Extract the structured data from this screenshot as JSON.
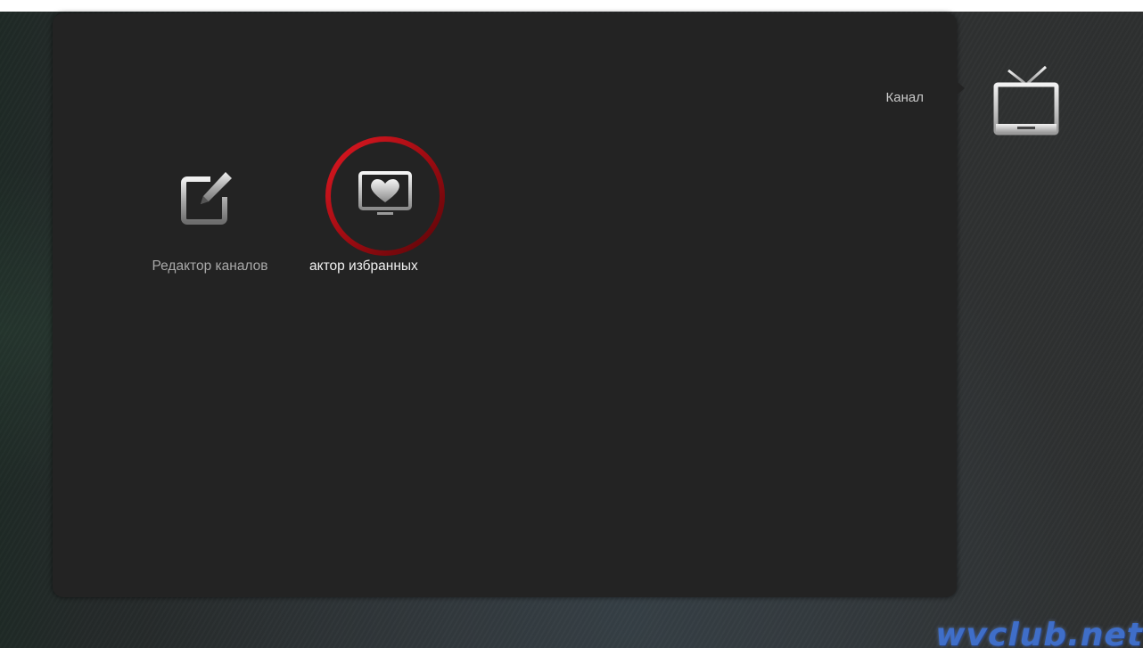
{
  "header": {
    "category_label": "Канал"
  },
  "menu": {
    "items": [
      {
        "label": "Редактор каналов",
        "icon": "edit-icon",
        "selected": false
      },
      {
        "label": "актор избранных",
        "icon": "favorites-tv-icon",
        "selected": true
      }
    ]
  },
  "category_icon": "tv-icon",
  "watermark": "wvclub.net",
  "colors": {
    "panel": "#232323",
    "selection_ring": "#c0121a",
    "label_selected": "#f2f2f2",
    "label_normal": "#a9a9a9",
    "watermark": "#3f6ec8"
  }
}
